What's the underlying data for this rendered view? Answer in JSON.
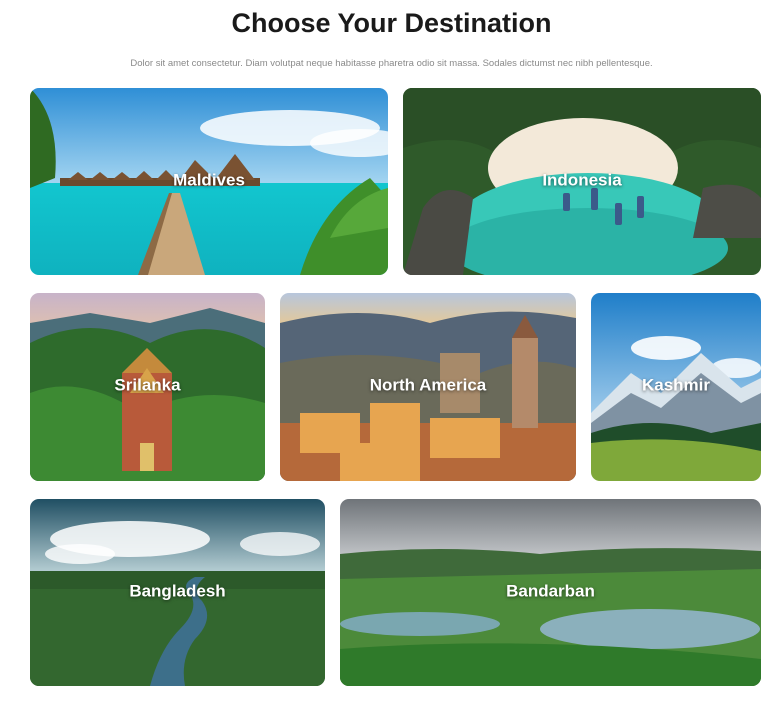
{
  "header": {
    "title": "Choose Your Destination",
    "subtitle": "Dolor sit amet consectetur. Diam volutpat neque habitasse pharetra odio sit massa. Sodales dictumst nec nibh pellentesque."
  },
  "destinations": [
    {
      "name": "Maldives",
      "scene": "overwater villas, wooden pier, turquoise lagoon, palm leaves"
    },
    {
      "name": "Indonesia",
      "scene": "aerial white-sand cove, boats, jungle cliffs"
    },
    {
      "name": "Srilanka",
      "scene": "temple tower on forested hilltop"
    },
    {
      "name": "North America",
      "scene": "hillside village at dusk, church tower"
    },
    {
      "name": "Kashmir",
      "scene": "snowy mountains, pine forest, green meadow"
    },
    {
      "name": "Bangladesh",
      "scene": "aerial river through forest, cloudy sky"
    },
    {
      "name": "Bandarban",
      "scene": "green valley with lakes, grey sky"
    }
  ]
}
